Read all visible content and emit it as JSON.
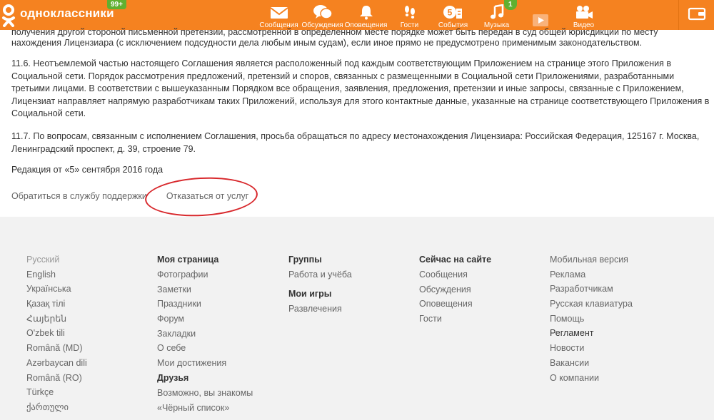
{
  "header": {
    "logo_text": "одноклассники",
    "logo_badge": "99+",
    "brand_color": "#f58220",
    "nav": [
      {
        "label": "Сообщения",
        "icon": "envelope-icon"
      },
      {
        "label": "Обсуждения",
        "icon": "chat-bubbles-icon"
      },
      {
        "label": "Оповещения",
        "icon": "bell-icon"
      },
      {
        "label": "Гости",
        "icon": "footprints-icon"
      },
      {
        "label": "События",
        "icon": "events-icon"
      },
      {
        "label": "Музыка",
        "icon": "music-note-icon",
        "badge": "1"
      },
      {
        "label": "",
        "icon": "video-play-icon"
      },
      {
        "label": "Видео",
        "icon": "video-camera-icon"
      }
    ],
    "wallet_icon": "wallet-icon"
  },
  "content": {
    "partial_line": "получения другой стороной письменной претензии, рассмотренной в определенном месте порядке может быть передан в суд общей юрисдикции по месту",
    "para1_line2": "нахождения Лицензиара (с исключением подсудности дела любым иным судам), если иное прямо не предусмотрено применимым законодательством.",
    "para_11_6": "11.6. Неотъемлемой частью настоящего Соглашения является расположенный под каждым соответствующим Приложением на странице этого Приложения в Социальной сети. Порядок рассмотрения предложений, претензий и споров, связанных с размещенными в Социальной сети Приложениями, разработанными третьими лицами. В соответствии с вышеуказанным Порядком все обращения, заявления, предложения, претензии и иные запросы, связанные с Приложением, Лицензиат направляет напрямую разработчикам таких Приложений, используя для этого контактные данные, указанные на странице соответствующего Приложения в Социальной сети.",
    "para_11_7": "11.7. По вопросам, связанным с исполнением Соглашения, просьба обращаться по адресу местонахождения Лицензиара: Российская Федерация, 125167 г. Москва, Ленинградский проспект, д. 39, строение 79.",
    "edition": "Редакция от «5» сентября 2016 года",
    "support_link": "Обратиться в службу поддержки",
    "refuse_link": "Отказаться от услуг"
  },
  "footer": {
    "languages": [
      "Русский",
      "English",
      "Українська",
      "Қазақ тілі",
      "Հայերեն",
      "O'zbek tili",
      "Română (MD)",
      "Azərbaycan dili",
      "Română (RO)",
      "Türkçe",
      "ქართული"
    ],
    "my_page": {
      "title": "Моя страница",
      "items": [
        "Фотографии",
        "Заметки",
        "Праздники",
        "Форум",
        "Закладки",
        "О себе",
        "Мои достижения"
      ]
    },
    "friends": {
      "title": "Друзья",
      "items": [
        "Возможно, вы знакомы",
        "«Чёрный список»"
      ]
    },
    "groups": {
      "title": "Группы",
      "items": [
        "Работа и учёба"
      ]
    },
    "my_games": {
      "title": "Мои игры",
      "items": [
        "Развлечения"
      ]
    },
    "now_on_site": {
      "title": "Сейчас на сайте",
      "items": [
        "Сообщения",
        "Обсуждения",
        "Оповещения",
        "Гости"
      ]
    },
    "misc": [
      "Мобильная версия",
      "Реклама",
      "Разработчикам",
      "Русская клавиатура",
      "Помощь",
      "Регламент",
      "Новости",
      "Вакансии",
      "О компании"
    ]
  },
  "annotation_color": "#d8282c"
}
